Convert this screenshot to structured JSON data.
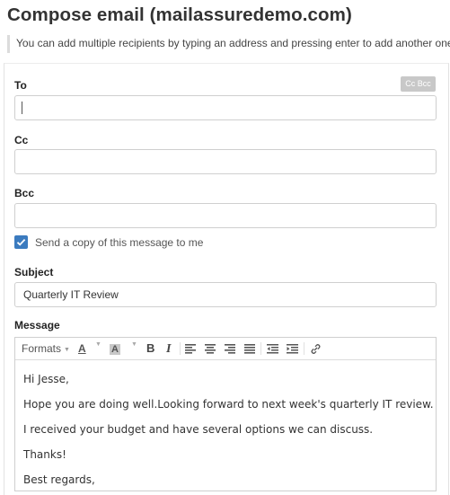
{
  "page": {
    "title": "Compose email (mailassuredemo.com)",
    "hint": "You can add multiple recipients by typing an address and pressing enter to add another one"
  },
  "to": {
    "label": "To",
    "value": "",
    "cc_bcc_label": "Cc Bcc"
  },
  "cc": {
    "label": "Cc",
    "value": ""
  },
  "bcc": {
    "label": "Bcc",
    "value": ""
  },
  "copy_to_me": {
    "label": "Send a copy of this message to me",
    "checked": true
  },
  "subject": {
    "label": "Subject",
    "value": "Quarterly IT Review"
  },
  "message": {
    "label": "Message",
    "toolbar": {
      "formats_label": "Formats",
      "text_color_label": "A",
      "background_color_label": "A",
      "bold_label": "B",
      "italic_label": "I",
      "icons": [
        "align-left-icon",
        "align-center-icon",
        "align-right-icon",
        "align-justify-icon",
        "outdent-icon",
        "indent-icon",
        "link-icon"
      ]
    },
    "lines": [
      "Hi Jesse,",
      "Hope you are doing well.Looking forward to next week's quarterly IT review.",
      "I received your budget and have several options we can discuss.",
      "Thanks!",
      "Best regards,"
    ]
  },
  "colors": {
    "accent": "#3b7bbf",
    "border": "#cfcfcf",
    "muted_button": "#c8c8c8"
  }
}
